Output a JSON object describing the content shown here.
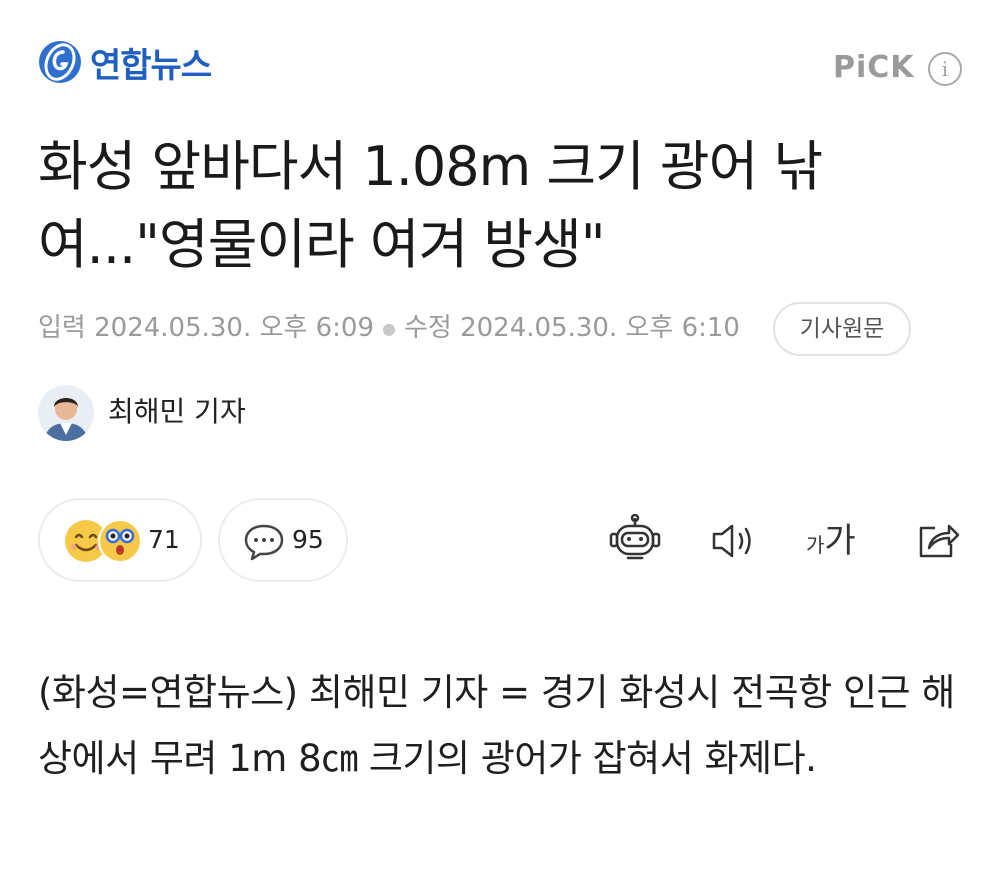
{
  "header": {
    "logo_text": "연합뉴스",
    "pick_label": "PiCK",
    "info_glyph": "i"
  },
  "article": {
    "headline": "화성 앞바다서 1.08m 크기 광어 낚여...\"영물이라 여겨 방생\"",
    "meta": {
      "input_label": "입력 2024.05.30. 오후 6:09",
      "edit_label": "수정 2024.05.30. 오후 6:10",
      "original_button": "기사원문"
    },
    "reporter": {
      "name": "최해민 기자"
    },
    "body": "(화성=연합뉴스) 최해민 기자 = 경기 화성시 전곡항 인근 해상에서 무려 1m 8㎝ 크기의 광어가 잡혀서 화제다."
  },
  "actions": {
    "reaction_count": "71",
    "comment_count": "95",
    "font_size_small": "가",
    "font_size_large": "가"
  },
  "icons": {
    "logo": "yonhap-logo-icon",
    "info": "info-icon",
    "reactions": [
      "smile-emoji-icon",
      "surprised-emoji-icon"
    ],
    "comment": "speech-bubble-icon",
    "summary": "robot-icon",
    "tts": "speaker-icon",
    "font": "font-size-icon",
    "share": "share-icon"
  },
  "colors": {
    "brand": "#1f5fbf",
    "muted": "#9a9a9a",
    "emoji": "#f7c948"
  }
}
